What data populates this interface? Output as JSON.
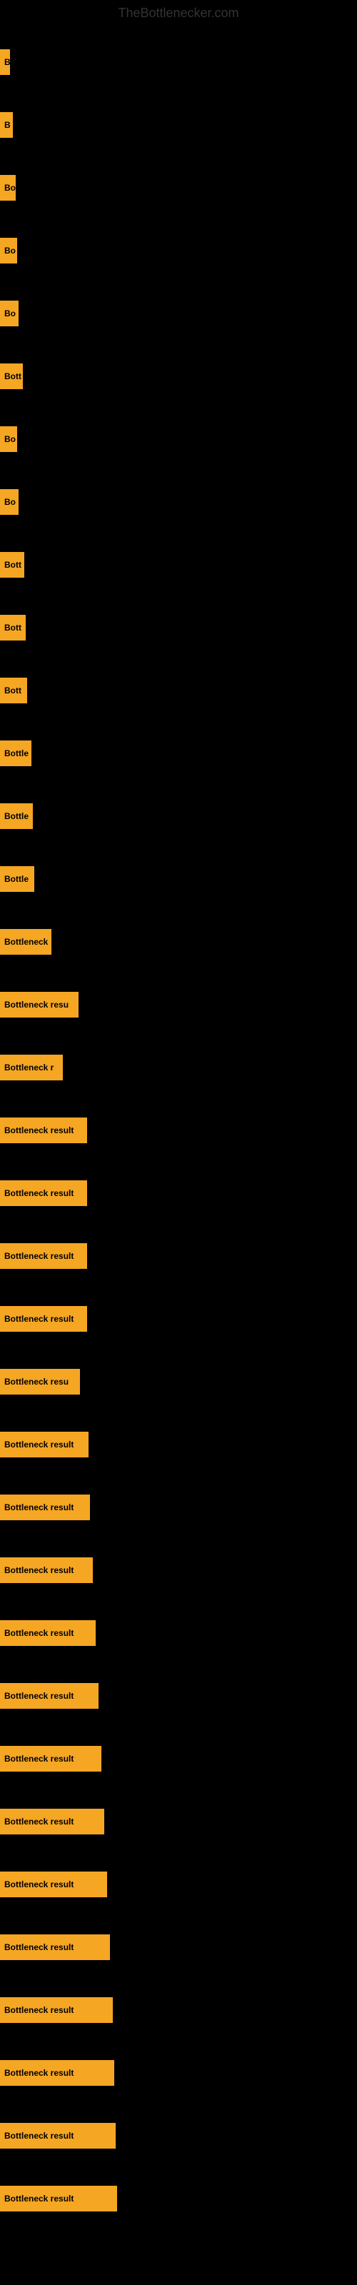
{
  "site": {
    "title": "TheBottlenecker.com"
  },
  "bars": [
    {
      "label": "B",
      "width": 14
    },
    {
      "label": "B",
      "width": 18
    },
    {
      "label": "Bo",
      "width": 22
    },
    {
      "label": "Bo",
      "width": 24
    },
    {
      "label": "Bo",
      "width": 26
    },
    {
      "label": "Bott",
      "width": 32
    },
    {
      "label": "Bo",
      "width": 24
    },
    {
      "label": "Bo",
      "width": 26
    },
    {
      "label": "Bott",
      "width": 34
    },
    {
      "label": "Bott",
      "width": 36
    },
    {
      "label": "Bott",
      "width": 38
    },
    {
      "label": "Bottle",
      "width": 44
    },
    {
      "label": "Bottle",
      "width": 46
    },
    {
      "label": "Bottle",
      "width": 48
    },
    {
      "label": "Bottleneck",
      "width": 72
    },
    {
      "label": "Bottleneck resu",
      "width": 110
    },
    {
      "label": "Bottleneck r",
      "width": 88
    },
    {
      "label": "Bottleneck result",
      "width": 122
    },
    {
      "label": "Bottleneck result",
      "width": 122
    },
    {
      "label": "Bottleneck result",
      "width": 122
    },
    {
      "label": "Bottleneck result",
      "width": 122
    },
    {
      "label": "Bottleneck resu",
      "width": 112
    },
    {
      "label": "Bottleneck result",
      "width": 124
    },
    {
      "label": "Bottleneck result",
      "width": 126
    },
    {
      "label": "Bottleneck result",
      "width": 130
    },
    {
      "label": "Bottleneck result",
      "width": 134
    },
    {
      "label": "Bottleneck result",
      "width": 138
    },
    {
      "label": "Bottleneck result",
      "width": 142
    },
    {
      "label": "Bottleneck result",
      "width": 146
    },
    {
      "label": "Bottleneck result",
      "width": 150
    },
    {
      "label": "Bottleneck result",
      "width": 154
    },
    {
      "label": "Bottleneck result",
      "width": 158
    },
    {
      "label": "Bottleneck result",
      "width": 160
    },
    {
      "label": "Bottleneck result",
      "width": 162
    },
    {
      "label": "Bottleneck result",
      "width": 164
    }
  ]
}
